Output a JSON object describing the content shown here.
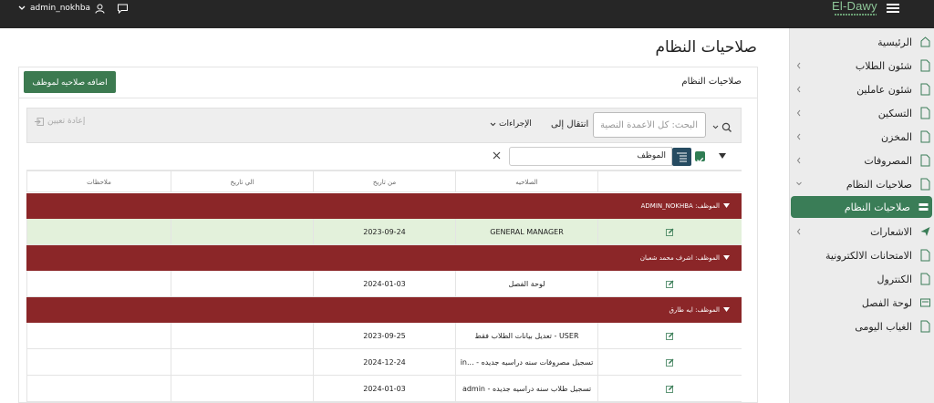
{
  "topbar": {
    "username": "admin_nokhba",
    "brand": "El-Dawy"
  },
  "sidebar": {
    "items": [
      {
        "label": "الرئيسية",
        "active": false,
        "expandable": false
      },
      {
        "label": "شئون الطلاب",
        "active": false,
        "expandable": true
      },
      {
        "label": "شئون عاملين",
        "active": false,
        "expandable": true
      },
      {
        "label": "التسكين",
        "active": false,
        "expandable": true
      },
      {
        "label": "المخزن",
        "active": false,
        "expandable": true
      },
      {
        "label": "المصروفات",
        "active": false,
        "expandable": true
      },
      {
        "label": "صلاحيات النظام",
        "active": false,
        "expandable": true,
        "expanded": true
      },
      {
        "label": "صلاحيات النظام",
        "active": true,
        "expandable": false
      },
      {
        "label": "الاشعارات",
        "active": false,
        "expandable": true
      },
      {
        "label": "الامتحانات الالكترونية",
        "active": false,
        "expandable": false
      },
      {
        "label": "الكنترول",
        "active": false,
        "expandable": false
      },
      {
        "label": "لوحة الفصل",
        "active": false,
        "expandable": false
      },
      {
        "label": "الغياب اليومى",
        "active": false,
        "expandable": false
      }
    ]
  },
  "main": {
    "page_title": "صلاحيات النظام",
    "card_title": "صلاحيات النظام",
    "add_button": "اضافه صلاحيه لموظف",
    "search_placeholder": "البحث: كل الأعمدة النصية",
    "goto_label": "انتقال إلى",
    "actions_label": "الإجراءات",
    "reset_label": "إعادة تعيين",
    "group_by_value": "الموظف",
    "columns": [
      "الصلاحيه",
      "من تاريخ",
      "الي تاريخ",
      "ملاحظات"
    ],
    "groups": [
      {
        "label": "الموظف: ADMIN_NOKHBA",
        "rows": [
          {
            "permission": "GENERAL MANAGER",
            "from": "2023-09-24",
            "to": "",
            "notes": "",
            "highlight": true
          }
        ]
      },
      {
        "label": "الموظف: اشرف محمد شعبان",
        "rows": [
          {
            "permission": "لوحة الفصل",
            "from": "2024-01-03",
            "to": "",
            "notes": "",
            "highlight": false
          }
        ]
      },
      {
        "label": "الموظف: ايه طارق",
        "rows": [
          {
            "permission": "USER - تعديل بيانات الطلاب فقط",
            "from": "2023-09-25",
            "to": "",
            "notes": "",
            "highlight": false
          },
          {
            "permission": "تسجيل مصروفات سنه دراسيه جديده - ...in",
            "from": "2024-12-24",
            "to": "",
            "notes": "",
            "highlight": false
          },
          {
            "permission": "تسجيل طلاب سنه دراسيه جديده - admin",
            "from": "2024-01-03",
            "to": "",
            "notes": "",
            "highlight": false
          }
        ]
      }
    ]
  },
  "colors": {
    "topbar": "#262626",
    "accent_green": "#3a7d57",
    "group_band": "#8b2628",
    "highlight_row": "#e3f1db"
  }
}
